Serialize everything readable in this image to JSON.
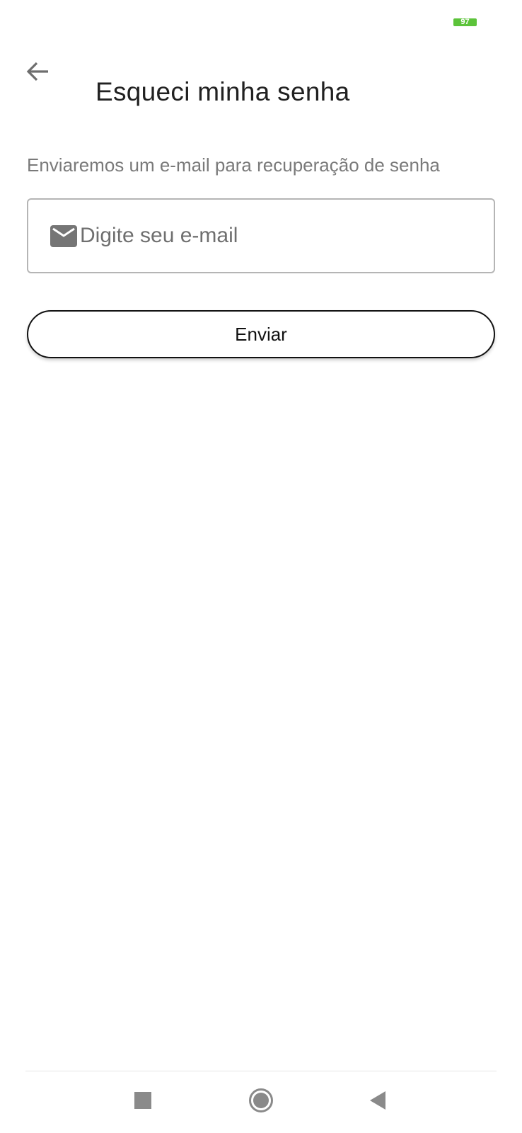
{
  "status_bar": {
    "battery_level": "97",
    "battery_color": "#5cc33a"
  },
  "header": {
    "back_icon": "arrow-left-icon",
    "title": "Esqueci minha senha"
  },
  "main": {
    "description": "Enviaremos um e-mail para recuperação de senha",
    "email_field": {
      "icon": "mail-icon",
      "placeholder": "Digite seu e-mail",
      "value": ""
    },
    "submit_label": "Enviar"
  },
  "nav_bar": {
    "recents_icon": "square-icon",
    "home_icon": "circle-icon",
    "back_icon": "triangle-back-icon"
  }
}
